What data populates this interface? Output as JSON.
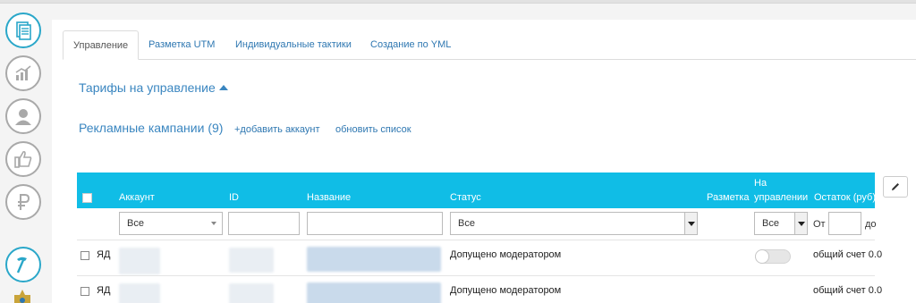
{
  "sidebar": {
    "icons": [
      {
        "name": "documents-icon",
        "active": true
      },
      {
        "name": "analytics-chart-icon",
        "active": false
      },
      {
        "name": "user-profile-icon",
        "active": false
      },
      {
        "name": "thumbs-up-icon",
        "active": false
      },
      {
        "name": "ruble-icon",
        "active": false
      },
      {
        "name": "hammer-icon",
        "active": true
      }
    ]
  },
  "tabs": [
    {
      "label": "Управление",
      "active": true
    },
    {
      "label": "Разметка UTM",
      "active": false
    },
    {
      "label": "Индивидуальные тактики",
      "active": false
    },
    {
      "label": "Создание по YML",
      "active": false
    }
  ],
  "tariffs": {
    "title": "Тарифы на управление"
  },
  "campaigns": {
    "title": "Рекламные кампании (9)",
    "add_account": "+добавить аккаунт",
    "refresh": "обновить список"
  },
  "table": {
    "headers": {
      "account": "Аккаунт",
      "id": "ID",
      "name": "Название",
      "status": "Статус",
      "markup": "Разметка",
      "managed_1": "На",
      "managed_2": "управлении",
      "balance": "Остаток (руб)"
    },
    "filters": {
      "account": "Все",
      "status": "Все",
      "managed": "Все",
      "from": "От",
      "to": "до"
    },
    "rows": [
      {
        "system": "ЯД",
        "status": "Допущено модератором",
        "balance": "общий счет 0.0"
      },
      {
        "system": "ЯД",
        "status": "Допущено модератором",
        "balance": "общий счет 0.0"
      }
    ]
  },
  "colors": {
    "accent": "#10bde6",
    "link": "#2e77b1",
    "heading": "#3a86c0"
  }
}
